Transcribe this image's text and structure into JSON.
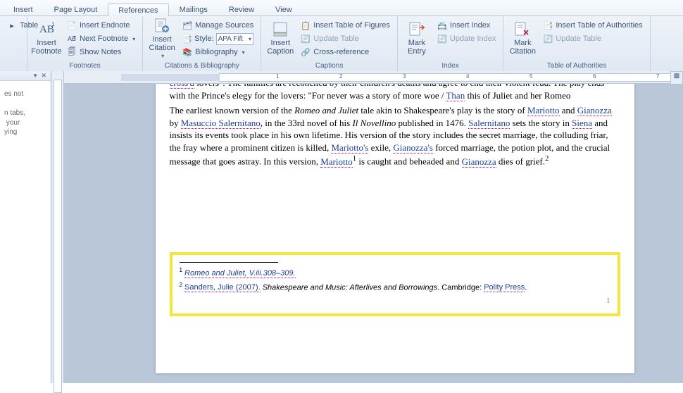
{
  "tabs": [
    "Insert",
    "Page Layout",
    "References",
    "Mailings",
    "Review",
    "View"
  ],
  "active_tab": 2,
  "ribbon": {
    "footnotes": {
      "label": "Footnotes",
      "insert_footnote": "Insert\nFootnote",
      "insert_endnote": "Insert Endnote",
      "next_footnote": "Next Footnote",
      "show_notes": "Show Notes"
    },
    "citations": {
      "label": "Citations & Bibliography",
      "insert_citation": "Insert\nCitation",
      "manage_sources": "Manage Sources",
      "style_label": "Style:",
      "style_value": "APA Fift",
      "bibliography": "Bibliography"
    },
    "captions": {
      "label": "Captions",
      "insert_caption": "Insert\nCaption",
      "insert_tof": "Insert Table of Figures",
      "update_table": "Update Table",
      "cross_ref": "Cross-reference"
    },
    "index": {
      "label": "Index",
      "mark_entry": "Mark\nEntry",
      "insert_index": "Insert Index",
      "update_index": "Update Index"
    },
    "toa": {
      "label": "Table of Authorities",
      "mark_citation": "Mark\nCitation",
      "insert_toa": "Insert Table of Authorities",
      "update_table": "Update Table"
    },
    "misc": {
      "table": "Table"
    }
  },
  "side_panel": {
    "text1": "es not",
    "text2": "n tabs,\n your\nying"
  },
  "doc": {
    "p1_a": "cross'd",
    "p1_b": " lovers\". The families are reconciled by their children's deaths and agree to end their violent feud. The play ends with the Prince's elegy for the lovers: \"For never was a story of more woe / ",
    "p1_c": "Than",
    "p1_d": " this of Juliet and her Romeo",
    "p2_a": "The earliest known version of the ",
    "p2_b": "Romeo and Juliet",
    "p2_c": " tale akin to Shakespeare's play is the story of ",
    "p2_d": "Mariotto",
    "p2_e": " and ",
    "p2_f": "Gianozza",
    "p2_g": " by ",
    "p2_h": "Masuccio Salernitano",
    "p2_i": ", in the 33rd novel of his ",
    "p2_j": "Il Novellino",
    "p2_k": " published in 1476. ",
    "p2_l": "Salernitano",
    "p2_m": " sets the story in ",
    "p2_n": "Siena",
    "p2_o": " and insists its events took place in his own lifetime. His version of the story includes the secret marriage, the colluding friar, the fray where a prominent citizen is killed, ",
    "p2_p": "Mariotto's",
    "p2_q": " exile, ",
    "p2_r": "Gianozza's",
    "p2_s": " forced marriage, the potion plot, and the crucial message that goes astray. In this version, ",
    "p2_t": "Mariotto",
    "p2_u": " is caught and beheaded and ",
    "p2_v": "Gianozza",
    "p2_w": " dies of grief.",
    "fn1": "Romeo and Juliet, V.iii.308–309.",
    "fn2_a": "Sanders, Julie (2007).",
    "fn2_b": "Shakespeare and Music: Afterlives and Borrowings",
    "fn2_c": ". Cambridge: ",
    "fn2_d": "Polity Press",
    "page_num": "1"
  },
  "ruler_marks": [
    "1",
    "2",
    "3",
    "4",
    "5",
    "6",
    "7"
  ]
}
